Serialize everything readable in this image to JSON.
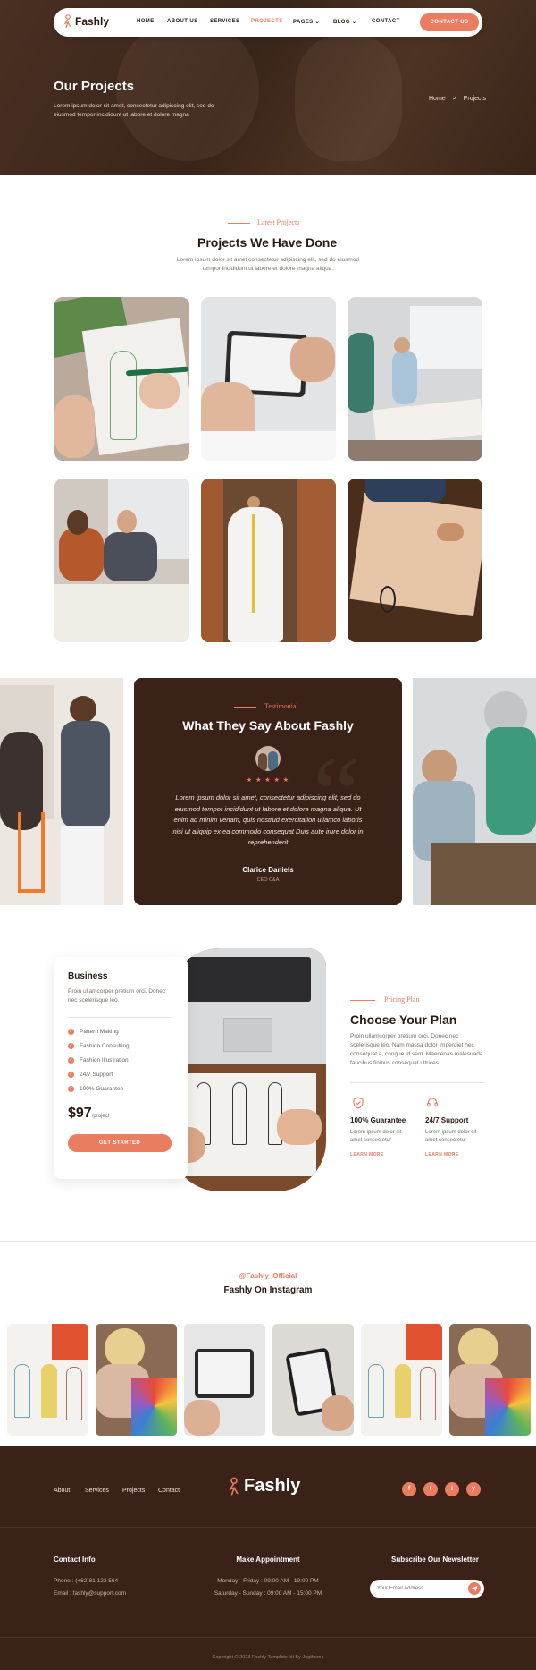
{
  "brand": {
    "name": "Fashly"
  },
  "nav": {
    "items": [
      {
        "label": "HOME"
      },
      {
        "label": "ABOUT US"
      },
      {
        "label": "SERVICES"
      },
      {
        "label": "PROJECTS",
        "active": true
      },
      {
        "label": "PAGES"
      },
      {
        "label": "BLOG"
      },
      {
        "label": "CONTACT"
      }
    ],
    "cta": "CONTACT US"
  },
  "hero": {
    "title": "Our Projects",
    "text": "Lorem ipsum dolor sit amet, consectetur adipiscing elit, sed do eiusmod tempor incididunt ut labore et dolore magna",
    "breadcrumb": {
      "home": "Home",
      "separator": ">",
      "current": "Projects"
    }
  },
  "projects": {
    "kicker": "Latest Projects",
    "title": "Projects We Have Done",
    "text": "Lorem ipsum dolor sit amet consectetur adipiscing elit, sed do eiusmod tempor incididunt ut labore et dolore magna aliqua."
  },
  "testimonial": {
    "kicker": "Testimonial",
    "title": "What They Say About Fashly",
    "stars": "★ ★ ★ ★ ★",
    "quote": "Lorem ipsum dolor sit amet, consectetur adipiscing elit, sed do eiusmod tempor incididunt ut labore et dolore magna aliqua. Ut enim ad minim venam, quis nostrud exercitation ullamco laboris nisi ut aliquip ex ea commodo consequat Duis aute irure dolor in reprehenderit",
    "name": "Clarice Daniels",
    "role": "CEO C&A"
  },
  "pricing": {
    "plan": "Business",
    "plan_text": "Proin ullamcorper pretium orci. Donec nec scelerisque leo.",
    "features": [
      "Pattern Making",
      "Fashion Consulting",
      "Fashion Illustration",
      "24/7 Support",
      "100% Guarantee"
    ],
    "price": "$97",
    "per": "/project",
    "button": "GET STARTED",
    "kicker": "Pricing Plan",
    "title": "Choose Your Plan",
    "text": "Proin ullamcorper pretium orci. Donec nec scelerisque leo. Nam massa dolor imperdiet nec consequat a, congue id sem. Maecenas malesuada faucibus finibus consequat ultrices.",
    "boxes": [
      {
        "title": "100% Guarantee",
        "text": "Lorem ipsum dolor sit amet consectetur",
        "link": "LEARN MORE"
      },
      {
        "title": "24/7 Support",
        "text": "Lorem ipsum dolor sit amet consectetur",
        "link": "LEARN MORE"
      }
    ]
  },
  "instagram": {
    "handle": "@Fashly_Official",
    "title": "Fashly On Instagram"
  },
  "footer": {
    "links": [
      "About",
      "Services",
      "Projects",
      "Contact"
    ],
    "social": [
      "f",
      "t",
      "i",
      "y"
    ],
    "contact": {
      "title": "Contact Info",
      "phone": "Phone : (+62)81 123 564",
      "email": "Email : fashly@support.com"
    },
    "appointment": {
      "title": "Make Appointment",
      "weekday": "Monday - Friday : 09:00 AM - 19:00 PM",
      "weekend": "Saturday - Sunday : 09:00 AM - 15:00 PM"
    },
    "newsletter": {
      "title": "Subscribe Our Newsletter",
      "placeholder": "Your Email Address"
    },
    "copyright": "Copyright © 2023 Fashly Template kit By Jegtheme"
  },
  "colors": {
    "accent": "#ea7c5f",
    "dark": "#3a2218",
    "text": "#2b1a10"
  }
}
